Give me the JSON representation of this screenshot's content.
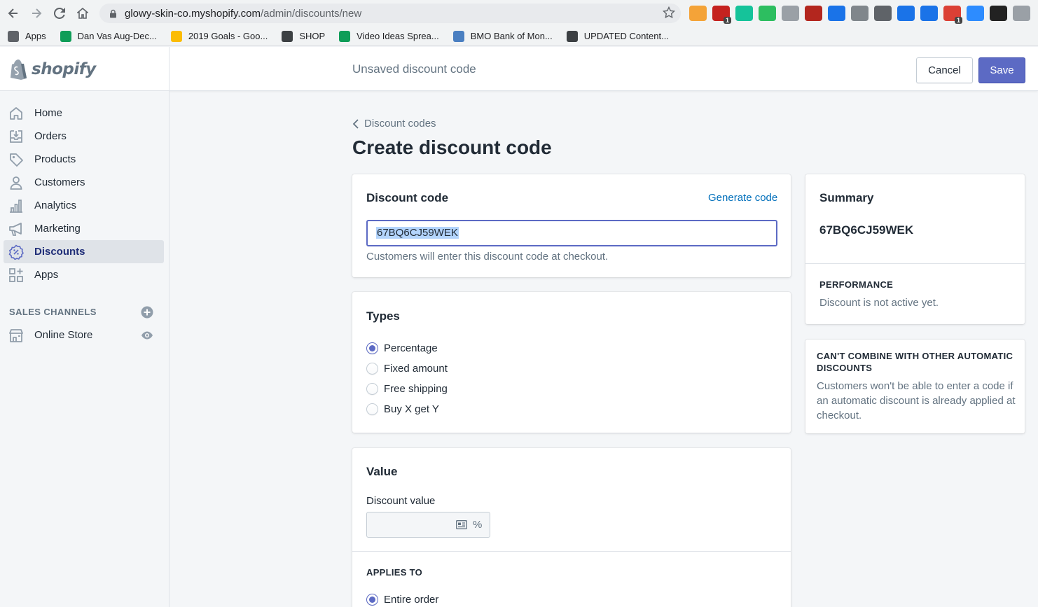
{
  "browser": {
    "url_host": "glowy-skin-co.myshopify.com",
    "url_path": "/admin/discounts/new",
    "bookmarks": [
      {
        "label": "Apps",
        "color": "#5f6368"
      },
      {
        "label": "Dan Vas Aug-Dec...",
        "color": "#0f9d58"
      },
      {
        "label": "2019 Goals - Goo...",
        "color": "#fbbc04"
      },
      {
        "label": "SHOP",
        "color": "#3c4043"
      },
      {
        "label": "Video Ideas Sprea...",
        "color": "#0f9d58"
      },
      {
        "label": "BMO Bank of Mon...",
        "color": "#4a7fc1"
      },
      {
        "label": "UPDATED Content...",
        "color": "#3c4043"
      }
    ],
    "extensions": [
      {
        "icon": "adscout-icon",
        "color": "#f4a338"
      },
      {
        "icon": "adblock-icon",
        "color": "#c5221f",
        "badge": "1"
      },
      {
        "icon": "grammarly-icon",
        "color": "#15c39a"
      },
      {
        "icon": "evernote-icon",
        "color": "#2dbe60"
      },
      {
        "icon": "screenshot-icon",
        "color": "#9aa0a6"
      },
      {
        "icon": "color-picker-icon",
        "color": "#b3261e"
      },
      {
        "icon": "keyword-icon",
        "color": "#1a73e8"
      },
      {
        "icon": "tab-icon",
        "color": "#80868b"
      },
      {
        "icon": "tubebuddy-icon",
        "color": "#5f6368"
      },
      {
        "icon": "iq-icon",
        "color": "#1a73e8"
      },
      {
        "icon": "reader-icon",
        "color": "#1a73e8"
      },
      {
        "icon": "todoist-icon",
        "color": "#db4035",
        "badge": "1"
      },
      {
        "icon": "zoom-icon",
        "color": "#2d8cff"
      },
      {
        "icon": "keepa-icon",
        "color": "#222222"
      },
      {
        "icon": "js-icon",
        "color": "#9aa0a6"
      }
    ]
  },
  "app": {
    "logo_text": "shopify",
    "title": "Unsaved discount code",
    "cancel_label": "Cancel",
    "save_label": "Save"
  },
  "sidebar": {
    "items": [
      {
        "label": "Home",
        "icon": "home-icon"
      },
      {
        "label": "Orders",
        "icon": "orders-icon"
      },
      {
        "label": "Products",
        "icon": "tag-icon"
      },
      {
        "label": "Customers",
        "icon": "person-icon"
      },
      {
        "label": "Analytics",
        "icon": "bar-chart-icon"
      },
      {
        "label": "Marketing",
        "icon": "megaphone-icon"
      },
      {
        "label": "Discounts",
        "icon": "discount-icon",
        "active": true
      },
      {
        "label": "Apps",
        "icon": "apps-icon"
      }
    ],
    "sales_channels_header": "SALES CHANNELS",
    "online_store_label": "Online Store"
  },
  "main": {
    "breadcrumb": "Discount codes",
    "heading": "Create discount code",
    "discount_code": {
      "title": "Discount code",
      "generate_label": "Generate code",
      "value": "67BQ6CJ59WEK",
      "help": "Customers will enter this discount code at checkout."
    },
    "types": {
      "title": "Types",
      "options": [
        {
          "label": "Percentage",
          "selected": true
        },
        {
          "label": "Fixed amount",
          "selected": false
        },
        {
          "label": "Free shipping",
          "selected": false
        },
        {
          "label": "Buy X get Y",
          "selected": false
        }
      ]
    },
    "value": {
      "title": "Value",
      "discount_value_label": "Discount value",
      "discount_value": "",
      "suffix": "%",
      "applies_to_header": "APPLIES TO",
      "applies_to_selected": "Entire order"
    }
  },
  "summary": {
    "title": "Summary",
    "code": "67BQ6CJ59WEK",
    "performance_header": "PERFORMANCE",
    "performance_text": "Discount is not active yet."
  },
  "combine": {
    "header": "CAN'T COMBINE WITH OTHER AUTOMATIC DISCOUNTS",
    "text": "Customers won't be able to enter a code if an automatic discount is already applied at checkout."
  }
}
